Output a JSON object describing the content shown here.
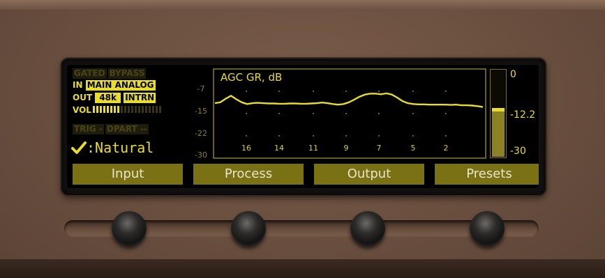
{
  "status": {
    "gated_label": "GATED",
    "bypass_label": "BYPASS",
    "in_label": "IN",
    "in_value": "MAIN ANALOG",
    "out_label": "OUT",
    "out_rate": "48k",
    "out_clock": "INTRN",
    "vol_label": "VOL",
    "vol_level": 0.4,
    "trig_label": "TRIG -",
    "dpart_label": "DPART --"
  },
  "preset": {
    "name": ":Natural",
    "check_icon": "check-icon"
  },
  "graph": {
    "title": "AGC GR, dB",
    "y_ticks": [
      "-7",
      "-15",
      "-22",
      "-30"
    ],
    "x_ticks": [
      "16",
      "14",
      "11",
      "9",
      "7",
      "5",
      "2"
    ]
  },
  "meter": {
    "top_label": "0",
    "value_label": "-12.2",
    "bottom_label": "-30",
    "level": 0.55
  },
  "softkeys": [
    "Input",
    "Process",
    "Output",
    "Presets"
  ],
  "colors": {
    "lcd_yellow": "#e8dc2e",
    "softkey_bg": "#7a7014",
    "chassis": "#6a4f3f"
  },
  "chart_data": {
    "type": "line",
    "title": "AGC GR, dB",
    "ylim": [
      -30,
      0
    ],
    "x_bands": [
      "16",
      "14",
      "11",
      "9",
      "7",
      "5",
      "2"
    ],
    "series": [
      {
        "values": [
          -11.5,
          -11.2,
          -10.0,
          -9.0,
          -10.2,
          -11.2,
          -11.8,
          -11.5,
          -11.4,
          -11.5,
          -11.6,
          -11.6,
          -11.7,
          -11.7,
          -11.6,
          -11.6,
          -11.7,
          -11.7,
          -11.6,
          -11.5,
          -11.3,
          -11.5,
          -11.8,
          -12.0,
          -11.8,
          -11.2,
          -10.3,
          -9.3,
          -8.6,
          -8.3,
          -8.3,
          -8.5,
          -8.2,
          -8.6,
          -9.6,
          -10.8,
          -11.5,
          -11.8,
          -11.9,
          -11.9,
          -12.0,
          -12.0,
          -12.0,
          -12.0,
          -12.1,
          -12.0,
          -12.2,
          -12.2,
          -12.3,
          -12.5,
          -12.8
        ]
      }
    ]
  }
}
